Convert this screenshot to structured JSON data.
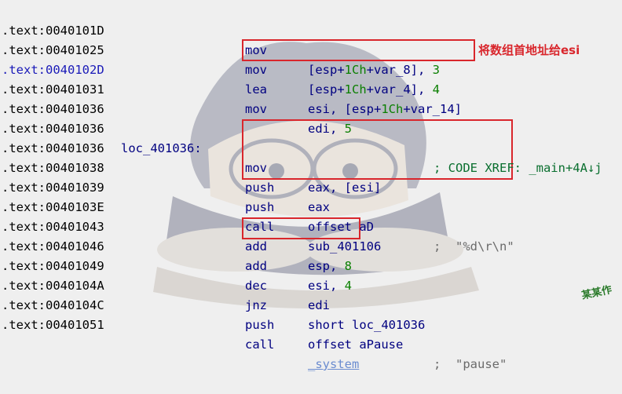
{
  "listing": [
    {
      "addr": ".text:0040101D",
      "mn": "mov",
      "op_pre": "[esp+",
      "op_num": "1Ch",
      "op_mid": "+var_8], ",
      "op_num2": "3",
      "op_post": ""
    },
    {
      "addr": ".text:00401025",
      "mn": "mov",
      "op_pre": "[esp+",
      "op_num": "1Ch",
      "op_mid": "+var_4], ",
      "op_num2": "4",
      "op_post": ""
    },
    {
      "addr": ".text:0040102D",
      "mn": "lea",
      "op_pre": "esi, [esp+",
      "op_num": "1Ch",
      "op_mid": "+var_14]",
      "op_num2": "",
      "op_post": ""
    },
    {
      "addr": ".text:00401031",
      "mn": "mov",
      "op_pre": "edi, ",
      "op_num": "",
      "op_mid": "",
      "op_num2": "5",
      "op_post": ""
    },
    {
      "addr": ".text:00401036",
      "mn": "",
      "op_pre": "",
      "op_num": "",
      "op_mid": "",
      "op_num2": "",
      "op_post": ""
    },
    {
      "addr": ".text:00401036",
      "mn": "",
      "op_pre": "",
      "op_num": "",
      "op_mid": "",
      "op_num2": "",
      "op_post": ""
    },
    {
      "addr": ".text:00401036",
      "mn": "mov",
      "op_pre": "eax, [esi]",
      "op_num": "",
      "op_mid": "",
      "op_num2": "",
      "op_post": ""
    },
    {
      "addr": ".text:00401038",
      "mn": "push",
      "op_pre": "eax",
      "op_num": "",
      "op_mid": "",
      "op_num2": "",
      "op_post": ""
    },
    {
      "addr": ".text:00401039",
      "mn": "push",
      "op_pre": "offset aD",
      "op_num": "",
      "op_mid": "",
      "op_num2": "",
      "op_post": ""
    },
    {
      "addr": ".text:0040103E",
      "mn": "call",
      "op_pre": "sub_401106",
      "op_num": "",
      "op_mid": "",
      "op_num2": "",
      "op_post": ""
    },
    {
      "addr": ".text:00401043",
      "mn": "add",
      "op_pre": "esp, ",
      "op_num": "",
      "op_mid": "",
      "op_num2": "8",
      "op_post": ""
    },
    {
      "addr": ".text:00401046",
      "mn": "add",
      "op_pre": "esi, ",
      "op_num": "",
      "op_mid": "",
      "op_num2": "4",
      "op_post": ""
    },
    {
      "addr": ".text:00401049",
      "mn": "dec",
      "op_pre": "edi",
      "op_num": "",
      "op_mid": "",
      "op_num2": "",
      "op_post": ""
    },
    {
      "addr": ".text:0040104A",
      "mn": "jnz",
      "op_pre": "short loc_401036",
      "op_num": "",
      "op_mid": "",
      "op_num2": "",
      "op_post": ""
    },
    {
      "addr": ".text:0040104C",
      "mn": "push",
      "op_pre": "offset aPause",
      "op_num": "",
      "op_mid": "",
      "op_num2": "",
      "op_post": ""
    },
    {
      "addr": ".text:00401051",
      "mn": "call",
      "op_pre": "",
      "op_num": "",
      "op_mid": "",
      "op_num2": "",
      "op_post": ""
    }
  ],
  "label_loc": "loc_401036:",
  "xref_comment": "; CODE XREF: _main+4A↓j",
  "comment_aD": ";  \"%d\\r\\n\"",
  "comment_aPause": ";  \"pause\"",
  "system_name": "_system",
  "annotation": "将数组首地址给esi",
  "watermark_signature": "某某作",
  "colors": {
    "highlight_box": "#d9262c",
    "address_selected": "#1a1ab8",
    "mnemonic": "#000080",
    "number": "#0a7f00",
    "xref": "#0a6f2f",
    "comment": "#6b6b6b"
  }
}
